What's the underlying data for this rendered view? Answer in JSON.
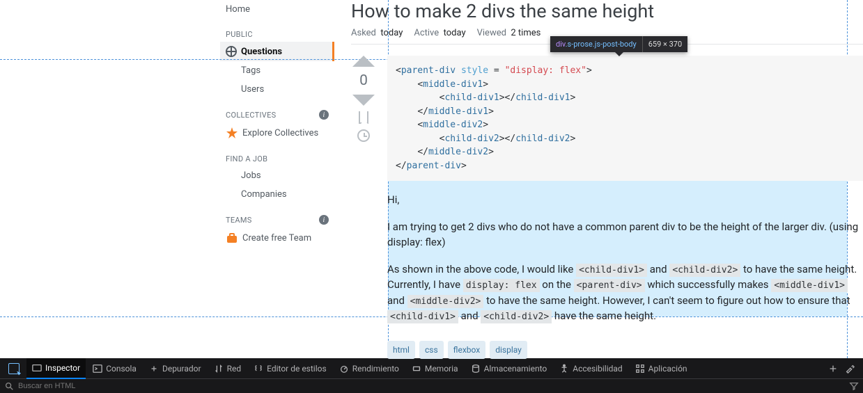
{
  "sidebar": {
    "home": "Home",
    "public_header": "PUBLIC",
    "questions": "Questions",
    "tags": "Tags",
    "users": "Users",
    "collectives_header": "COLLECTIVES",
    "explore_collectives": "Explore Collectives",
    "findjob_header": "FIND A JOB",
    "jobs": "Jobs",
    "companies": "Companies",
    "teams_header": "TEAMS",
    "create_team": "Create free Team"
  },
  "question": {
    "title": "How to make 2 divs the same height",
    "asked_label": "Asked",
    "asked_value": "today",
    "active_label": "Active",
    "active_value": "today",
    "viewed_label": "Viewed",
    "viewed_value": "2 times",
    "score": "0"
  },
  "body": {
    "p1": "Hi,",
    "p2": "I am trying to get 2 divs who do not have a common parent div to be the height of the larger div. (using display: flex)",
    "p3a": "As shown in the above code, I would like ",
    "p3b": " and ",
    "p3c": " to have the same height. Currently, I have ",
    "p3d": " on the ",
    "p3e": " which successfully makes ",
    "p3f": " and ",
    "p3g": " to have the same height. However, I can't seem to figure out how to ensure that ",
    "p3h": " and ",
    "p3i": " have the same height.",
    "code_child1": "<child-div1>",
    "code_child2": "<child-div2>",
    "code_displayflex": "display: flex",
    "code_parent": "<parent-div>",
    "code_middle1": "<middle-div1>",
    "code_middle2": "<middle-div2>"
  },
  "tags": [
    "html",
    "css",
    "flexbox",
    "display"
  ],
  "tooltip": {
    "el": "div",
    "cls": ".s-prose.js-post-body",
    "dims": "659 × 370"
  },
  "devtools": {
    "tabs": {
      "inspector": "Inspector",
      "consola": "Consola",
      "depurador": "Depurador",
      "red": "Red",
      "estilos": "Editor de estilos",
      "rendimiento": "Rendimiento",
      "memoria": "Memoria",
      "almacenamiento": "Almacenamiento",
      "accesibilidad": "Accesibilidad",
      "aplicacion": "Aplicación"
    },
    "search_placeholder": "Buscar en HTML"
  }
}
